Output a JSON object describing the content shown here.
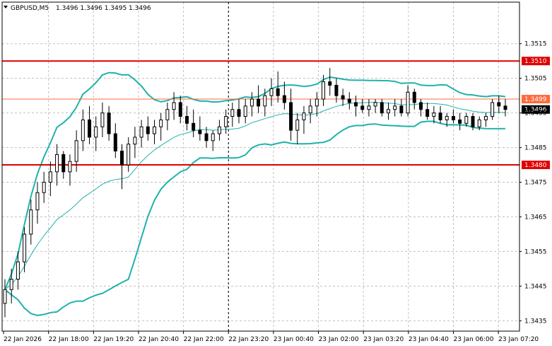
{
  "header": {
    "symbol_label": "GBPUSD,M5",
    "ohlc": "1.3496 1.3496 1.3495 1.3496"
  },
  "colors": {
    "background": "#ffffff",
    "grid": "#c0c0c0",
    "bollinger": "#20b2aa",
    "sma": "#20b2aa",
    "support_resistance": "#e00000",
    "level_1_3499": "#ff6a3d",
    "candle": "#000000",
    "current_price_box": "#000000"
  },
  "chart_data": {
    "type": "candlestick",
    "symbol": "GBPUSD",
    "timeframe": "M5",
    "ylim": [
      1.3432,
      1.3527
    ],
    "grid": true,
    "y_ticks": [
      "1.3515",
      "1.3505",
      "1.3495",
      "1.3485",
      "1.3475",
      "1.3465",
      "1.3455",
      "1.3445",
      "1.3435"
    ],
    "x_ticks": [
      "22 Jan 2026",
      "22 Jan 18:00",
      "22 Jan 19:20",
      "22 Jan 20:40",
      "22 Jan 22:00",
      "22 Jan 23:20",
      "23 Jan 00:40",
      "23 Jan 02:00",
      "23 Jan 03:20",
      "23 Jan 04:40",
      "23 Jan 06:00",
      "23 Jan 07:20"
    ],
    "vertical_marker_label": "22 Jan 23:20",
    "horizontal_levels": [
      {
        "value": 1.351,
        "label": "1.3510",
        "role": "resistance"
      },
      {
        "value": 1.3499,
        "label": "1.3499",
        "role": "level"
      },
      {
        "value": 1.348,
        "label": "1.3480",
        "role": "support"
      }
    ],
    "current_price": {
      "value": 1.3496,
      "label": "1.3496"
    },
    "candles": [
      [
        1.344,
        1.3447,
        1.3436,
        1.3444
      ],
      [
        1.3444,
        1.345,
        1.344,
        1.3447
      ],
      [
        1.3447,
        1.3455,
        1.3444,
        1.3452
      ],
      [
        1.3452,
        1.3462,
        1.3449,
        1.346
      ],
      [
        1.346,
        1.347,
        1.3457,
        1.3467
      ],
      [
        1.3467,
        1.3475,
        1.3463,
        1.3472
      ],
      [
        1.3472,
        1.3478,
        1.3469,
        1.3475
      ],
      [
        1.3475,
        1.3481,
        1.3471,
        1.3478
      ],
      [
        1.3478,
        1.3486,
        1.3474,
        1.3483
      ],
      [
        1.3483,
        1.3484,
        1.3476,
        1.3478
      ],
      [
        1.3478,
        1.3483,
        1.3474,
        1.3481
      ],
      [
        1.3481,
        1.349,
        1.3478,
        1.3487
      ],
      [
        1.3487,
        1.3496,
        1.3484,
        1.3493
      ],
      [
        1.3493,
        1.3497,
        1.3486,
        1.3488
      ],
      [
        1.3488,
        1.3494,
        1.3484,
        1.3491
      ],
      [
        1.3491,
        1.3498,
        1.3488,
        1.3495
      ],
      [
        1.3495,
        1.3497,
        1.3487,
        1.3489
      ],
      [
        1.3489,
        1.3492,
        1.3482,
        1.3484
      ],
      [
        1.3484,
        1.3486,
        1.3473,
        1.348
      ],
      [
        1.348,
        1.3488,
        1.3478,
        1.3486
      ],
      [
        1.3486,
        1.3491,
        1.3482,
        1.3488
      ],
      [
        1.3488,
        1.3493,
        1.3485,
        1.3491
      ],
      [
        1.3491,
        1.3494,
        1.3487,
        1.3489
      ],
      [
        1.3489,
        1.3493,
        1.3486,
        1.3491
      ],
      [
        1.3491,
        1.3495,
        1.3487,
        1.3493
      ],
      [
        1.3493,
        1.3498,
        1.349,
        1.3496
      ],
      [
        1.3496,
        1.3501,
        1.3493,
        1.3498
      ],
      [
        1.3498,
        1.35,
        1.3492,
        1.3494
      ],
      [
        1.3494,
        1.3497,
        1.349,
        1.3492
      ],
      [
        1.3492,
        1.3496,
        1.3488,
        1.349
      ],
      [
        1.349,
        1.3494,
        1.3487,
        1.3489
      ],
      [
        1.3489,
        1.3491,
        1.3485,
        1.3487
      ],
      [
        1.3487,
        1.349,
        1.3484,
        1.3489
      ],
      [
        1.3489,
        1.3493,
        1.3487,
        1.3491
      ],
      [
        1.3491,
        1.3496,
        1.3489,
        1.3494
      ],
      [
        1.3494,
        1.3498,
        1.3491,
        1.3496
      ],
      [
        1.3496,
        1.3499,
        1.3492,
        1.3494
      ],
      [
        1.3494,
        1.3499,
        1.3492,
        1.3497
      ],
      [
        1.3497,
        1.3501,
        1.3494,
        1.3499
      ],
      [
        1.3499,
        1.3503,
        1.3495,
        1.3497
      ],
      [
        1.3497,
        1.3502,
        1.3494,
        1.35
      ],
      [
        1.35,
        1.3505,
        1.3497,
        1.3502
      ],
      [
        1.3502,
        1.3507,
        1.3498,
        1.35
      ],
      [
        1.35,
        1.3504,
        1.3496,
        1.3498
      ],
      [
        1.3498,
        1.3502,
        1.3487,
        1.349
      ],
      [
        1.349,
        1.3495,
        1.3486,
        1.3493
      ],
      [
        1.3493,
        1.3497,
        1.3489,
        1.3495
      ],
      [
        1.3495,
        1.3499,
        1.3492,
        1.3497
      ],
      [
        1.3497,
        1.3501,
        1.3494,
        1.3499
      ],
      [
        1.3499,
        1.3506,
        1.3497,
        1.3504
      ],
      [
        1.3504,
        1.3508,
        1.35,
        1.3503
      ],
      [
        1.3503,
        1.3505,
        1.3498,
        1.35
      ],
      [
        1.35,
        1.3502,
        1.3497,
        1.3499
      ],
      [
        1.3499,
        1.3501,
        1.3496,
        1.3498
      ],
      [
        1.3498,
        1.35,
        1.3494,
        1.3497
      ],
      [
        1.3497,
        1.3499,
        1.3495,
        1.3496
      ],
      [
        1.3496,
        1.3499,
        1.3494,
        1.3497
      ],
      [
        1.3497,
        1.3499,
        1.3495,
        1.3498
      ],
      [
        1.3498,
        1.3499,
        1.3494,
        1.3495
      ],
      [
        1.3495,
        1.3498,
        1.3493,
        1.3496
      ],
      [
        1.3496,
        1.3499,
        1.3494,
        1.3497
      ],
      [
        1.3497,
        1.3499,
        1.3494,
        1.3495
      ],
      [
        1.3495,
        1.3503,
        1.3494,
        1.3501
      ],
      [
        1.3501,
        1.3502,
        1.3496,
        1.3498
      ],
      [
        1.3498,
        1.3499,
        1.3494,
        1.3496
      ],
      [
        1.3496,
        1.3498,
        1.3493,
        1.3494
      ],
      [
        1.3494,
        1.3497,
        1.3492,
        1.3495
      ],
      [
        1.3495,
        1.3497,
        1.3492,
        1.3493
      ],
      [
        1.3493,
        1.3495,
        1.3491,
        1.3494
      ],
      [
        1.3494,
        1.3496,
        1.3492,
        1.3493
      ],
      [
        1.3493,
        1.3495,
        1.349,
        1.3492
      ],
      [
        1.3492,
        1.3495,
        1.3491,
        1.3494
      ],
      [
        1.3494,
        1.3495,
        1.349,
        1.3491
      ],
      [
        1.3491,
        1.3494,
        1.349,
        1.3493
      ],
      [
        1.3493,
        1.3495,
        1.3491,
        1.3494
      ],
      [
        1.3494,
        1.3499,
        1.3493,
        1.3498
      ],
      [
        1.3498,
        1.35,
        1.3495,
        1.3497
      ],
      [
        1.3497,
        1.3499,
        1.3494,
        1.3496
      ]
    ]
  }
}
